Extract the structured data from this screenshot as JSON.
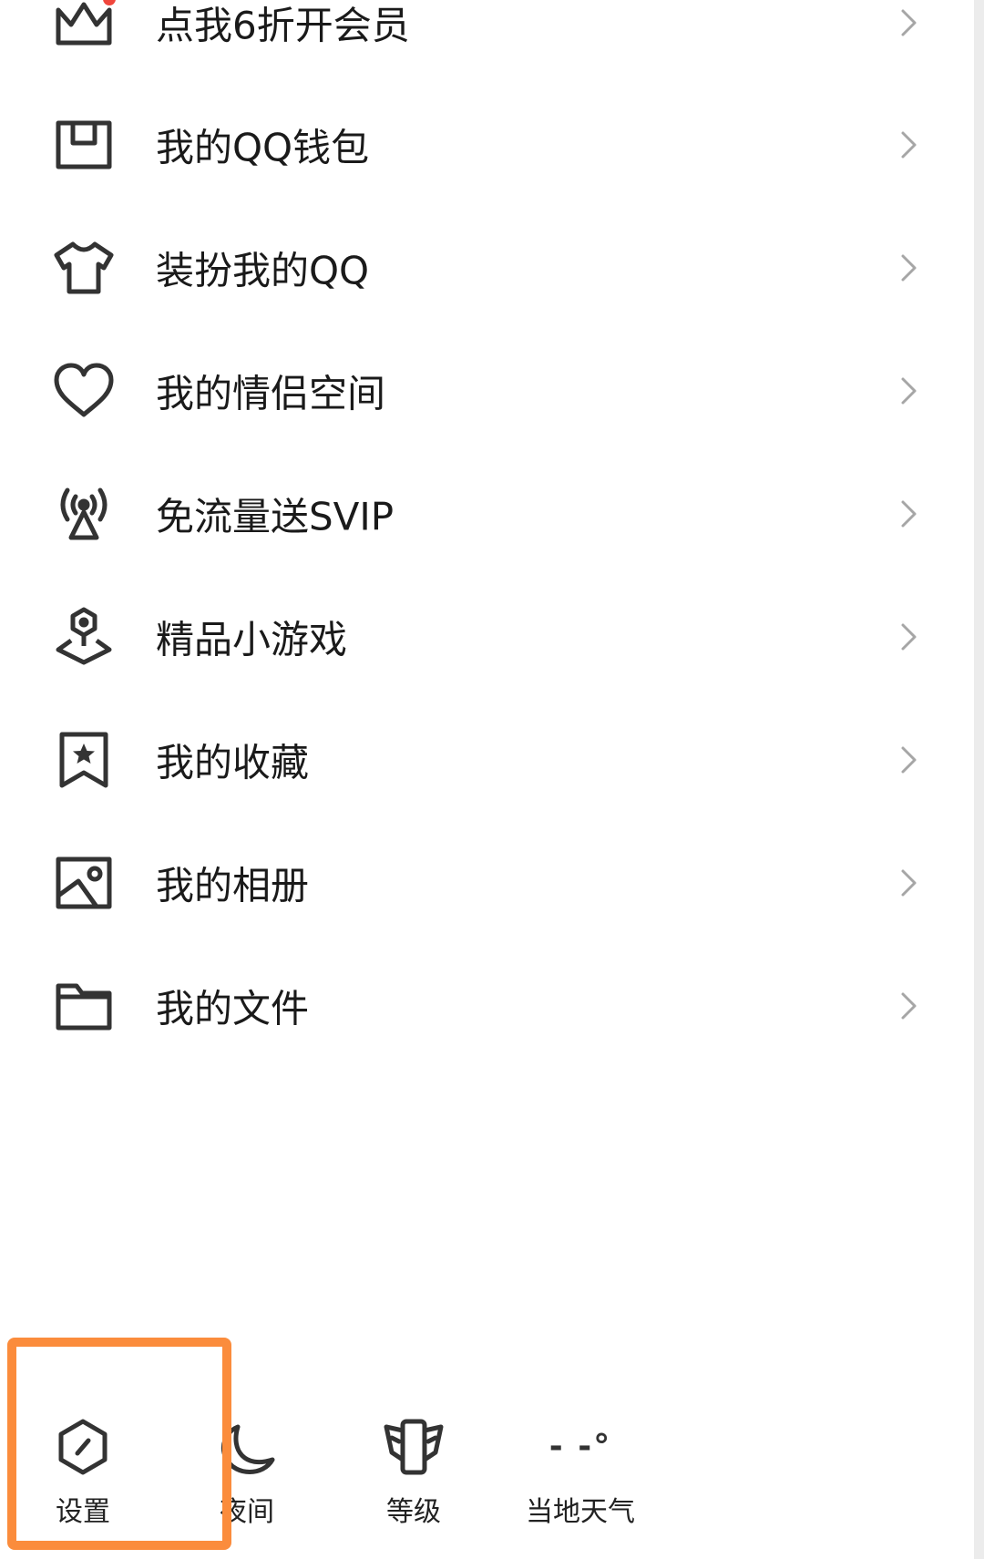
{
  "menu": {
    "items": [
      {
        "label": "点我6折开会员",
        "icon": "crown-icon",
        "has_badge": true
      },
      {
        "label": "我的QQ钱包",
        "icon": "wallet-icon"
      },
      {
        "label": "装扮我的QQ",
        "icon": "tshirt-icon"
      },
      {
        "label": "我的情侣空间",
        "icon": "heart-icon"
      },
      {
        "label": "免流量送SVIP",
        "icon": "signal-tower-icon"
      },
      {
        "label": "精品小游戏",
        "icon": "game-pin-icon"
      },
      {
        "label": "我的收藏",
        "icon": "bookmark-star-icon"
      },
      {
        "label": "我的相册",
        "icon": "photo-album-icon"
      },
      {
        "label": "我的文件",
        "icon": "folder-icon"
      }
    ]
  },
  "bottom_bar": {
    "settings": {
      "label": "设置",
      "icon": "settings-hexagon-icon"
    },
    "night": {
      "label": "夜间",
      "icon": "moon-icon"
    },
    "level": {
      "label": "等级",
      "icon": "level-badge-icon"
    },
    "weather": {
      "label": "当地天气",
      "icon": "weather-temperature-icon",
      "value": "- -°"
    }
  },
  "colors": {
    "highlight": "#fb8c3c",
    "badge": "#f0463c",
    "icon": "#333333",
    "chevron": "#a6a6a6",
    "text": "#1a1a1a"
  }
}
